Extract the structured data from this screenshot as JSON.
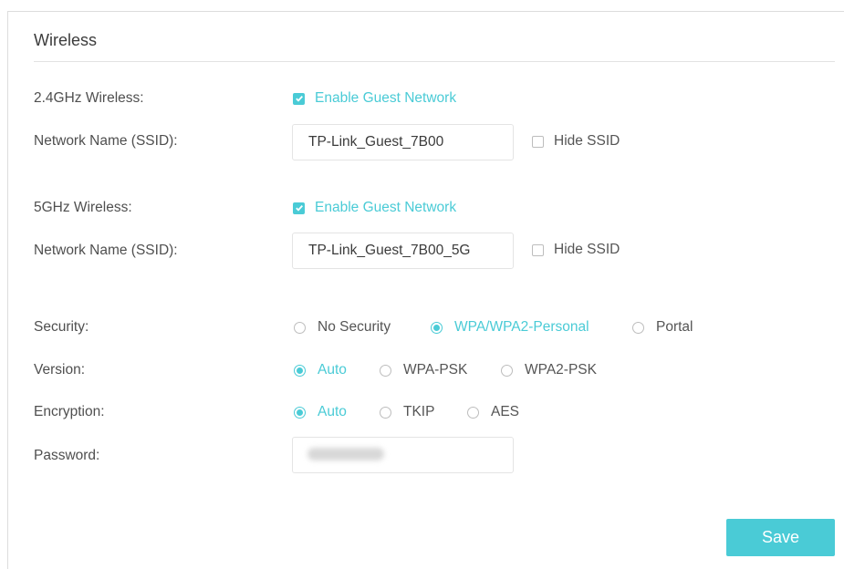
{
  "section": {
    "title": "Wireless"
  },
  "band24": {
    "label": "2.4GHz Wireless:",
    "enable_label": "Enable Guest Network",
    "enabled": true,
    "ssid_label": "Network Name (SSID):",
    "ssid_value": "TP-Link_Guest_7B00",
    "hide_ssid_label": "Hide SSID",
    "hide_ssid": false
  },
  "band5": {
    "label": "5GHz Wireless:",
    "enable_label": "Enable Guest Network",
    "enabled": true,
    "ssid_label": "Network Name (SSID):",
    "ssid_value": "TP-Link_Guest_7B00_5G",
    "hide_ssid_label": "Hide SSID",
    "hide_ssid": false
  },
  "security": {
    "label": "Security:",
    "options": [
      "No Security",
      "WPA/WPA2-Personal",
      "Portal"
    ],
    "selected": "WPA/WPA2-Personal"
  },
  "version": {
    "label": "Version:",
    "options": [
      "Auto",
      "WPA-PSK",
      "WPA2-PSK"
    ],
    "selected": "Auto"
  },
  "encryption": {
    "label": "Encryption:",
    "options": [
      "Auto",
      "TKIP",
      "AES"
    ],
    "selected": "Auto"
  },
  "password": {
    "label": "Password:"
  },
  "actions": {
    "save_label": "Save"
  },
  "colors": {
    "accent": "#4acbd6",
    "text": "#4a4a4a",
    "border": "#e4e4e4"
  }
}
